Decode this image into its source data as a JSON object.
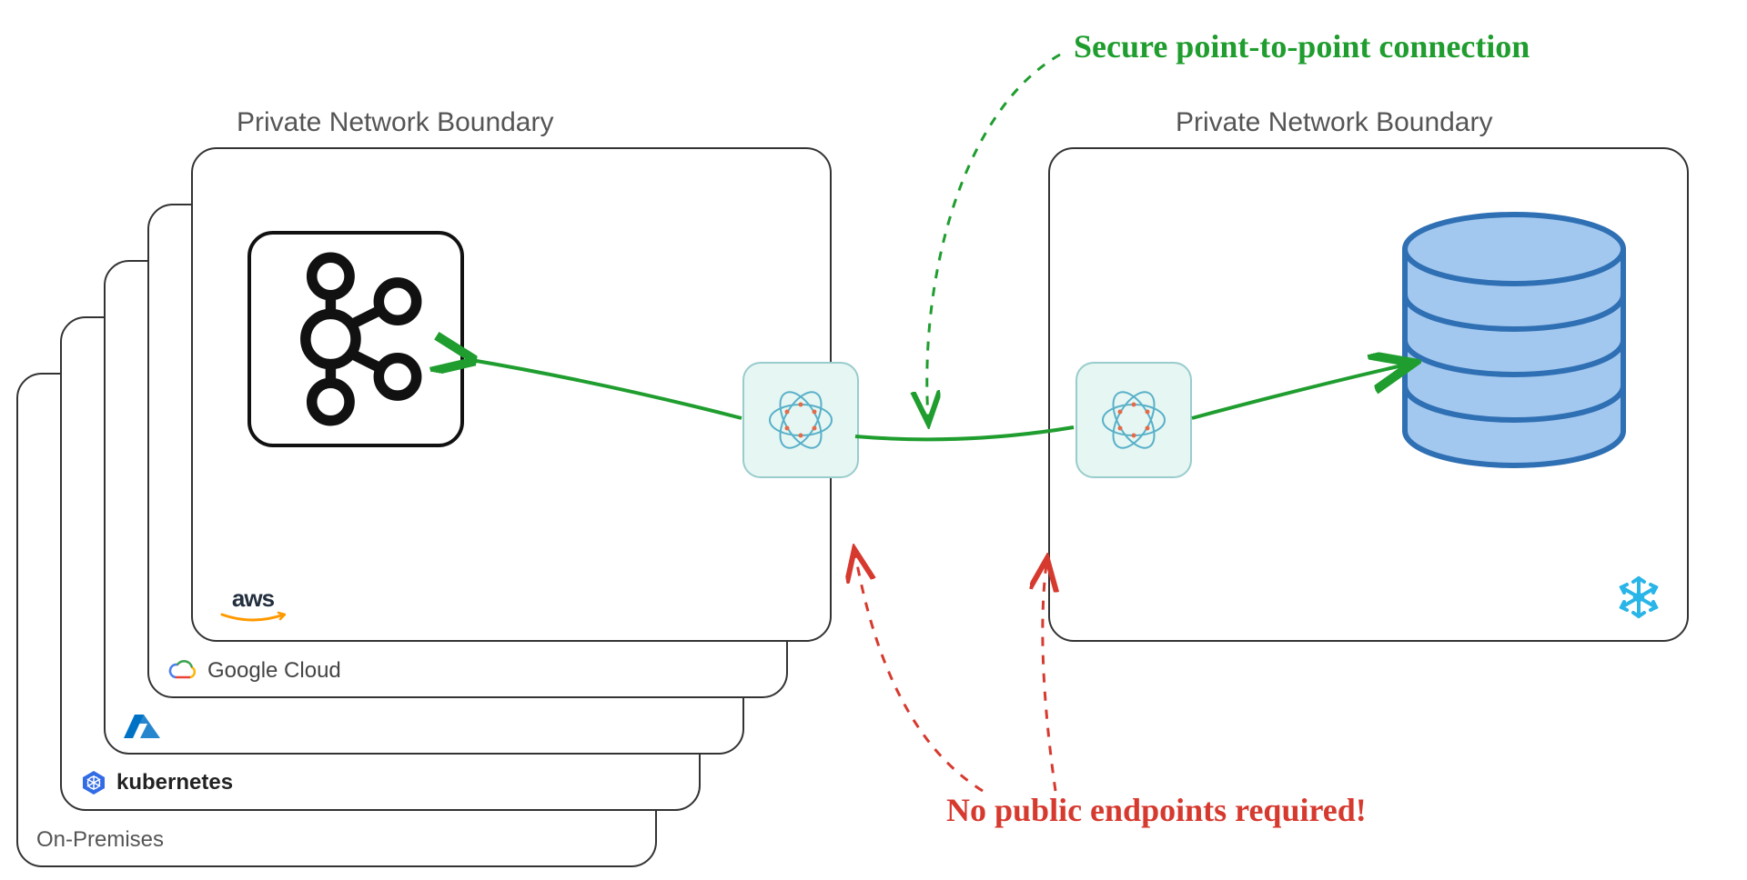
{
  "annotations": {
    "secure_connection": "Secure point-to-point connection",
    "no_public_endpoints": "No public endpoints required!"
  },
  "left_stack": {
    "boundary_title": "Private Network Boundary",
    "cards": [
      {
        "id": "on-premises",
        "label": "On-Premises"
      },
      {
        "id": "kubernetes",
        "label": "kubernetes"
      },
      {
        "id": "azure",
        "label": ""
      },
      {
        "id": "google-cloud",
        "label": "Google Cloud"
      },
      {
        "id": "aws",
        "label": "aws"
      }
    ]
  },
  "right_box": {
    "boundary_title": "Private Network Boundary"
  },
  "icons": {
    "kafka": "kafka-icon",
    "ockam": "ockam-portal-icon",
    "snowflake": "snowflake-icon",
    "database": "database-icon",
    "aws": "aws-icon",
    "gcp": "gcp-icon",
    "azure": "azure-icon",
    "kubernetes": "kubernetes-icon"
  },
  "colors": {
    "green": "#1f9d2e",
    "red": "#d63a2f",
    "db_fill": "#a3c8ef",
    "db_stroke": "#2f6fb3",
    "ockam_bg": "#e6f6f2",
    "snowflake": "#29b5e8"
  }
}
